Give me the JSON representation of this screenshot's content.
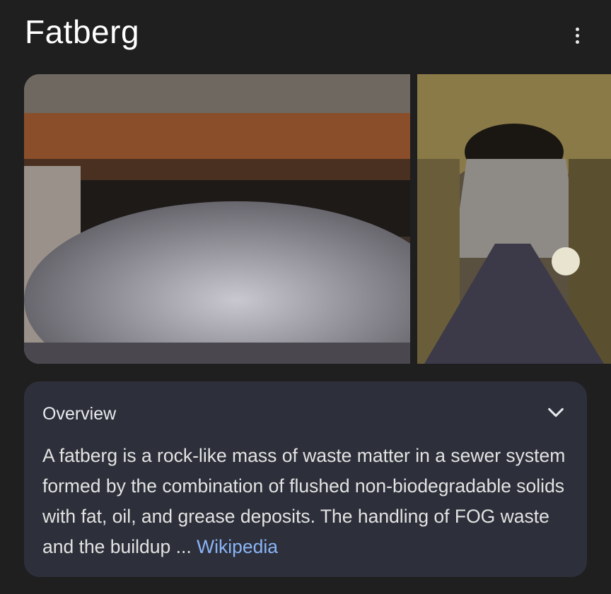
{
  "header": {
    "title": "Fatberg",
    "more_icon": "more-vert-icon"
  },
  "gallery": {
    "images": [
      {
        "name": "fatberg-sewer-photo-1"
      },
      {
        "name": "fatberg-sewer-photo-2"
      }
    ]
  },
  "overview": {
    "heading": "Overview",
    "expand_icon": "chevron-down-icon",
    "text": "A fatberg is a rock-like mass of waste matter in a sewer system formed by the combination of flushed non-biodegradable solids with fat, oil, and grease deposits. The handling of FOG waste and the buildup ... ",
    "source_link": "Wikipedia"
  },
  "colors": {
    "background": "#1f1f1f",
    "card": "#2d303a",
    "link": "#8ab4f8"
  }
}
